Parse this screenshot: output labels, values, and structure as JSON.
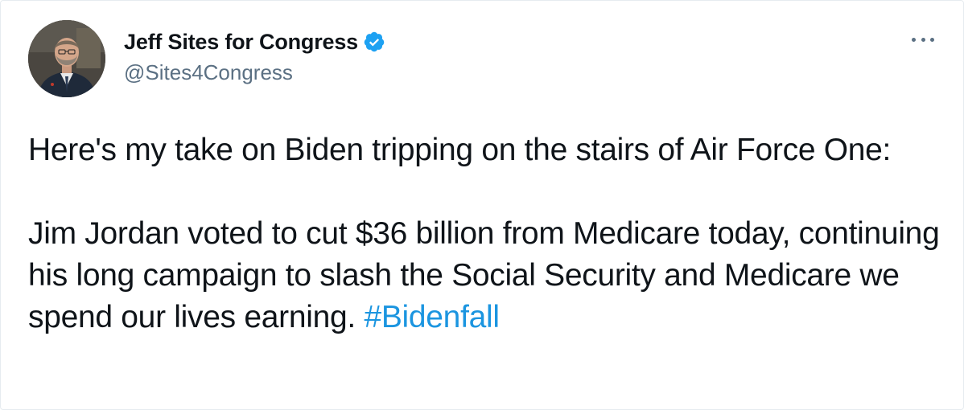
{
  "tweet": {
    "display_name": "Jeff Sites for Congress",
    "handle": "@Sites4Congress",
    "verified": true,
    "avatar_icon": "profile-photo",
    "more_icon": "more-options-icon",
    "text_line1": "Here's my take on Biden tripping on the stairs of Air Force One:",
    "text_para2": "Jim Jordan voted to cut $36 billion from Medicare today, continuing his long campaign to slash the Social Security and Medicare we spend our lives earning.",
    "hashtag": "#Bidenfall",
    "colors": {
      "text": "#0f1419",
      "secondary": "#5b7083",
      "link": "#1b95e0",
      "verified": "#1da1f2"
    }
  }
}
